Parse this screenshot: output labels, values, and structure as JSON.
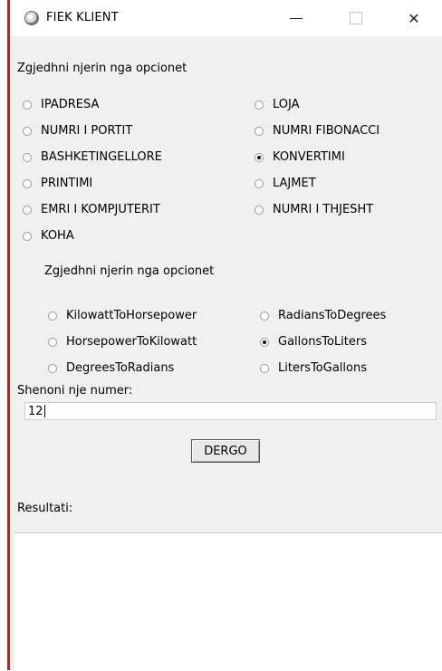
{
  "window": {
    "title": "FIEK KLIENT"
  },
  "main": {
    "prompt": "Zgjedhni njerin nga opcionet",
    "options": [
      {
        "label": "IPADRESA",
        "checked": false
      },
      {
        "label": "LOJA",
        "checked": false
      },
      {
        "label": "NUMRI I PORTIT",
        "checked": false
      },
      {
        "label": "NUMRI FIBONACCI",
        "checked": false
      },
      {
        "label": "BASHKETINGELLORE",
        "checked": false
      },
      {
        "label": "KONVERTIMI",
        "checked": true
      },
      {
        "label": "PRINTIMI",
        "checked": false
      },
      {
        "label": "LAJMET",
        "checked": false
      },
      {
        "label": "EMRI I KOMPJUTERIT",
        "checked": false
      },
      {
        "label": "NUMRI I THJESHT",
        "checked": false
      },
      {
        "label": "KOHA",
        "checked": false
      }
    ]
  },
  "conversion": {
    "prompt": "Zgjedhni njerin nga opcionet",
    "options": [
      {
        "label": "KilowattToHorsepower",
        "checked": false
      },
      {
        "label": "RadiansToDegrees",
        "checked": false
      },
      {
        "label": "HorsepowerToKilowatt",
        "checked": false
      },
      {
        "label": "GallonsToLiters",
        "checked": true
      },
      {
        "label": "DegreesToRadians",
        "checked": false
      },
      {
        "label": "LitersToGallons",
        "checked": false
      }
    ]
  },
  "input": {
    "label": "Shenoni nje numer:",
    "value": "12"
  },
  "submit": {
    "label": "DERGO"
  },
  "result": {
    "label": "Resultati:",
    "value": ""
  }
}
